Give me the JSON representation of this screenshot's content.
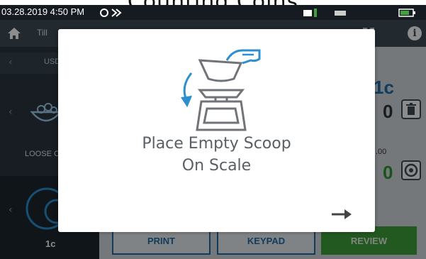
{
  "caption": "Counting Coins",
  "status": {
    "datetime": "03.28.2019  4:50 PM"
  },
  "topbar": {
    "title": "Till"
  },
  "sidebar": {
    "currency_label": "USD",
    "loose_label": "LOOSE C",
    "selected_denom": "1c"
  },
  "main": {
    "denom_big": "1c",
    "count_zero": "0",
    "small_value": ".00",
    "total_zero": "0"
  },
  "buttons": {
    "print": "PRINT",
    "keypad": "KEYPAD",
    "review": "REVIEW"
  },
  "modal": {
    "line1": "Place Empty Scoop",
    "line2": "On Scale"
  },
  "colors": {
    "accent_blue": "#1f6ea8",
    "review_green": "#3fa33b",
    "status_bar": "#151b20",
    "top_bar": "#3e4d58"
  },
  "icons": [
    "home-icon",
    "grid-icon",
    "info-icon",
    "trash-icon",
    "refresh-icon",
    "scale-icon",
    "scoop-hand-icon",
    "next-arrow-icon"
  ]
}
